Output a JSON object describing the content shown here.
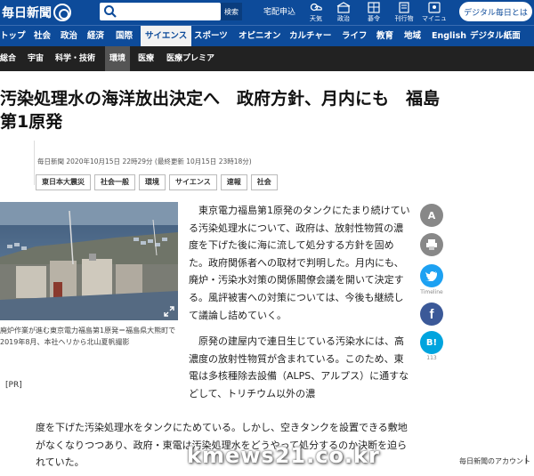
{
  "header": {
    "logo_text": "毎日新聞",
    "search_button": "検索",
    "delivery_link": "宅配申込",
    "icons": [
      {
        "name": "weather-icon",
        "label": "天気"
      },
      {
        "name": "politics-icon",
        "label": "政治"
      },
      {
        "name": "go-shogi-icon",
        "label": "碁令"
      },
      {
        "name": "press-icon",
        "label": "刊行物"
      },
      {
        "name": "manage-icon",
        "label": "マイニュース"
      }
    ],
    "digital_button": "デジタル毎日とは"
  },
  "nav": {
    "items": [
      "トップ",
      "社会",
      "政治",
      "経済",
      "国際",
      "サイエンス",
      "スポーツ",
      "オピニオン",
      "カルチャー",
      "ライフ",
      "教育",
      "地域",
      "English",
      "デジタル紙面"
    ],
    "active": "サイエンス"
  },
  "subnav": {
    "items": [
      "総合",
      "宇宙",
      "科学・技術",
      "環境",
      "医療",
      "医療プレミア"
    ],
    "active": "環境"
  },
  "article": {
    "title": "汚染処理水の海洋放出決定へ　政府方針、月内にも　福島第1原発",
    "byline": "毎日新聞 2020年10月15日 22時29分 (最終更新 10月15日 23時18分)",
    "tags": [
      "東日本大震災",
      "社会一般",
      "環境",
      "サイエンス",
      "速報",
      "社会"
    ],
    "caption": "廃炉作業が進む東京電力福島第1原発＝福島県大熊町で2019年8月、本社ヘリから北山夏帆撮影",
    "pr_label": "[PR]",
    "paragraph1": "東京電力福島第1原発のタンクにたまり続けている汚染処理水について、政府は、放射性物質の濃度を下げた後に海に流して処分する方針を固めた。政府関係者への取材で判明した。月内にも、廃炉・汚染水対策の関係閣僚会議を開いて決定する。風評被害への対策については、今後も継続して議論し詰めていく。",
    "paragraph2_top": "原発の建屋内で連日生じている汚染水には、高濃度の放射性物質が含まれている。このため、東電は多核種除去設備（ALPS、アルプス）に通すなどして、トリチウム以外の濃",
    "paragraph2_bottom": "度を下げた汚染処理水をタンクにためている。しかし、空きタンクを設置できる敷地がなくなりつつあり、政府・東電は汚染処理水をどうやって処分するのか決断を迫られていた。"
  },
  "share": {
    "font_size_label": "A",
    "twitter_label": "Timeline",
    "hatena_label": "B!",
    "hatena_count": "113"
  },
  "watermark": "kmews21.co.kr",
  "account_text": "毎日新聞のアカウント",
  "account_close": "|"
}
